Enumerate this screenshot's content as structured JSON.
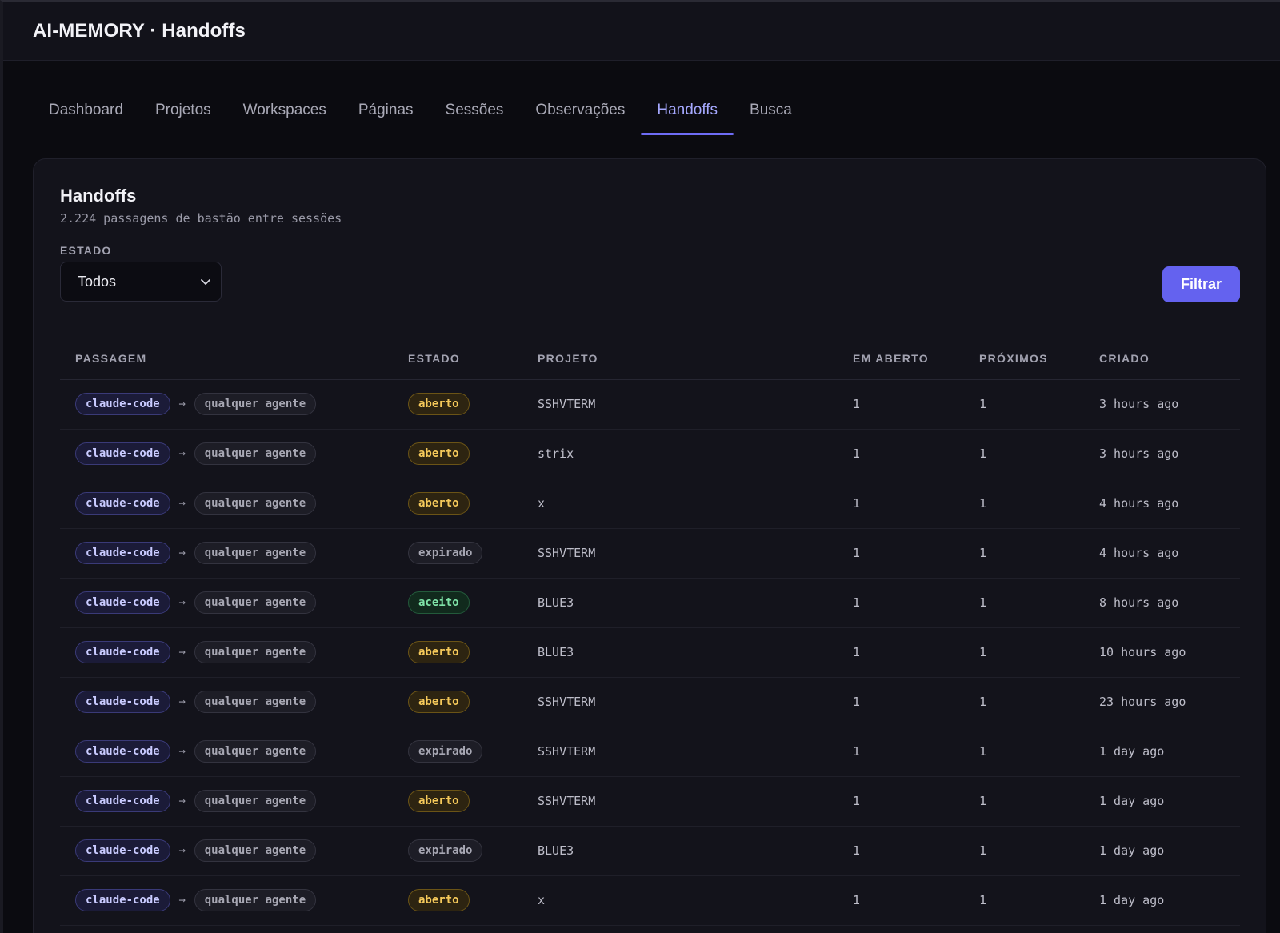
{
  "app": {
    "title": "AI-MEMORY · Handoffs"
  },
  "nav": {
    "tabs": [
      {
        "label": "Dashboard",
        "active": false
      },
      {
        "label": "Projetos",
        "active": false
      },
      {
        "label": "Workspaces",
        "active": false
      },
      {
        "label": "Páginas",
        "active": false
      },
      {
        "label": "Sessões",
        "active": false
      },
      {
        "label": "Observações",
        "active": false
      },
      {
        "label": "Handoffs",
        "active": true
      },
      {
        "label": "Busca",
        "active": false
      }
    ]
  },
  "card": {
    "title": "Handoffs",
    "subtitle": "2.224 passagens de bastão entre sessões"
  },
  "filter": {
    "label": "ESTADO",
    "selected": "Todos",
    "button_label": "Filtrar"
  },
  "table": {
    "headers": {
      "passagem": "PASSAGEM",
      "estado": "ESTADO",
      "projeto": "PROJETO",
      "em_aberto": "EM ABERTO",
      "proximos": "PRÓXIMOS",
      "criado": "CRIADO"
    },
    "arrow": "→",
    "rows": [
      {
        "from": "claude-code",
        "to": "qualquer agente",
        "estado": "aberto",
        "projeto": "SSHVTERM",
        "em_aberto": "1",
        "proximos": "1",
        "criado": "3 hours ago"
      },
      {
        "from": "claude-code",
        "to": "qualquer agente",
        "estado": "aberto",
        "projeto": "strix",
        "em_aberto": "1",
        "proximos": "1",
        "criado": "3 hours ago"
      },
      {
        "from": "claude-code",
        "to": "qualquer agente",
        "estado": "aberto",
        "projeto": "x",
        "em_aberto": "1",
        "proximos": "1",
        "criado": "4 hours ago"
      },
      {
        "from": "claude-code",
        "to": "qualquer agente",
        "estado": "expirado",
        "projeto": "SSHVTERM",
        "em_aberto": "1",
        "proximos": "1",
        "criado": "4 hours ago"
      },
      {
        "from": "claude-code",
        "to": "qualquer agente",
        "estado": "aceito",
        "projeto": "BLUE3",
        "em_aberto": "1",
        "proximos": "1",
        "criado": "8 hours ago"
      },
      {
        "from": "claude-code",
        "to": "qualquer agente",
        "estado": "aberto",
        "projeto": "BLUE3",
        "em_aberto": "1",
        "proximos": "1",
        "criado": "10 hours ago"
      },
      {
        "from": "claude-code",
        "to": "qualquer agente",
        "estado": "aberto",
        "projeto": "SSHVTERM",
        "em_aberto": "1",
        "proximos": "1",
        "criado": "23 hours ago"
      },
      {
        "from": "claude-code",
        "to": "qualquer agente",
        "estado": "expirado",
        "projeto": "SSHVTERM",
        "em_aberto": "1",
        "proximos": "1",
        "criado": "1 day ago"
      },
      {
        "from": "claude-code",
        "to": "qualquer agente",
        "estado": "aberto",
        "projeto": "SSHVTERM",
        "em_aberto": "1",
        "proximos": "1",
        "criado": "1 day ago"
      },
      {
        "from": "claude-code",
        "to": "qualquer agente",
        "estado": "expirado",
        "projeto": "BLUE3",
        "em_aberto": "1",
        "proximos": "1",
        "criado": "1 day ago"
      },
      {
        "from": "claude-code",
        "to": "qualquer agente",
        "estado": "aberto",
        "projeto": "x",
        "em_aberto": "1",
        "proximos": "1",
        "criado": "1 day ago"
      }
    ]
  },
  "icons": {
    "select_chevron": "chevron-down-icon"
  },
  "colors": {
    "accent": "#6462ef",
    "aberto": "#f5c95a",
    "aceito": "#7fe3a8",
    "expirado": "#a7a7b3"
  }
}
